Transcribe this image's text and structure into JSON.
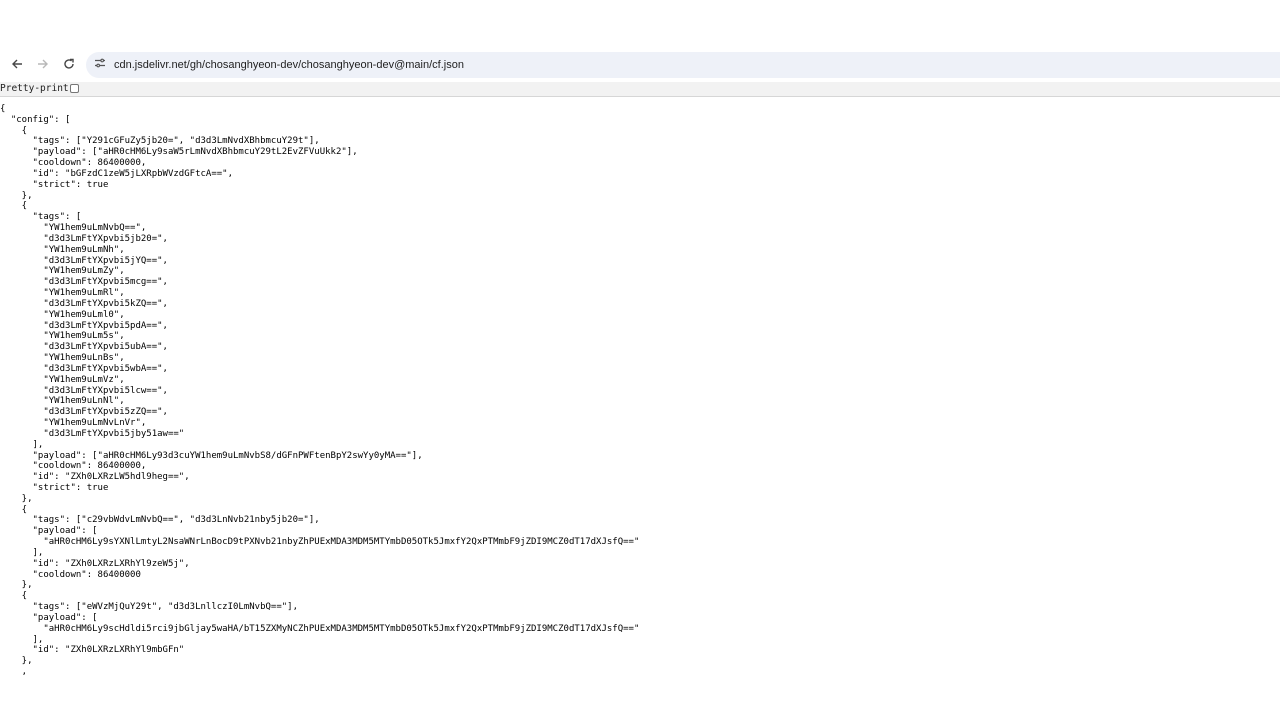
{
  "browser": {
    "url": "cdn.jsdelivr.net/gh/chosanghyeon-dev/chosanghyeon-dev@main/cf.json",
    "back_icon": "arrow-left-icon",
    "forward_icon": "arrow-right-icon",
    "reload_icon": "reload-icon",
    "site_info_icon": "tune-icon"
  },
  "viewer": {
    "pretty_print_label": "Pretty-print",
    "pretty_print_checked": false
  },
  "json_lines": [
    "{",
    "  \"config\": [",
    "    {",
    "      \"tags\": [\"Y291cGFuZy5jb20=\", \"d3d3LmNvdXBhbmcuY29t\"],",
    "      \"payload\": [\"aHR0cHM6Ly9saW5rLmNvdXBhbmcuY29tL2EvZFVuUkk2\"],",
    "      \"cooldown\": 86400000,",
    "      \"id\": \"bGFzdC1zeW5jLXRpbWVzdGFtcA==\",",
    "      \"strict\": true",
    "    },",
    "    {",
    "      \"tags\": [",
    "        \"YW1hem9uLmNvbQ==\",",
    "        \"d3d3LmFtYXpvbi5jb20=\",",
    "        \"YW1hem9uLmNh\",",
    "        \"d3d3LmFtYXpvbi5jYQ==\",",
    "        \"YW1hem9uLmZy\",",
    "        \"d3d3LmFtYXpvbi5mcg==\",",
    "        \"YW1hem9uLmRl\",",
    "        \"d3d3LmFtYXpvbi5kZQ==\",",
    "        \"YW1hem9uLml0\",",
    "        \"d3d3LmFtYXpvbi5pdA==\",",
    "        \"YW1hem9uLm5s\",",
    "        \"d3d3LmFtYXpvbi5ubA==\",",
    "        \"YW1hem9uLnBs\",",
    "        \"d3d3LmFtYXpvbi5wbA==\",",
    "        \"YW1hem9uLmVz\",",
    "        \"d3d3LmFtYXpvbi5lcw==\",",
    "        \"YW1hem9uLnNl\",",
    "        \"d3d3LmFtYXpvbi5zZQ==\",",
    "        \"YW1hem9uLmNvLnVr\",",
    "        \"d3d3LmFtYXpvbi5jby51aw==\"",
    "      ],",
    "      \"payload\": [\"aHR0cHM6Ly93d3cuYW1hem9uLmNvbS8/dGFnPWFtenBpY2swYy0yMA==\"],",
    "      \"cooldown\": 86400000,",
    "      \"id\": \"ZXh0LXRzLW5hdl9heg==\",",
    "      \"strict\": true",
    "    },",
    "    {",
    "      \"tags\": [\"c29vbWdvLmNvbQ==\", \"d3d3LnNvb21nby5jb20=\"],",
    "      \"payload\": [",
    "        \"aHR0cHM6Ly9sYXNlLmtyL2NsaWNrLnBocD9tPXNvb21nbyZhPUExMDA3MDM5MTYmbD05OTk5JmxfY2QxPTMmbF9jZDI9MCZ0dT17dXJsfQ==\"",
    "      ],",
    "      \"id\": \"ZXh0LXRzLXRhYl9zeW5j\",",
    "      \"cooldown\": 86400000",
    "    },",
    "    {",
    "      \"tags\": [\"eWVzMjQuY29t\", \"d3d3LnllczI0LmNvbQ==\"],",
    "      \"payload\": [",
    "        \"aHR0cHM6Ly9scHdldi5rci9jbGljay5waHA/bT15ZXMyNCZhPUExMDA3MDM5MTYmbD05OTk5JmxfY2QxPTMmbF9jZDI9MCZ0dT17dXJsfQ==\"",
    "      ],",
    "      \"id\": \"ZXh0LXRzLXRhYl9mbGFn\"",
    "    },",
    "    ,"
  ]
}
